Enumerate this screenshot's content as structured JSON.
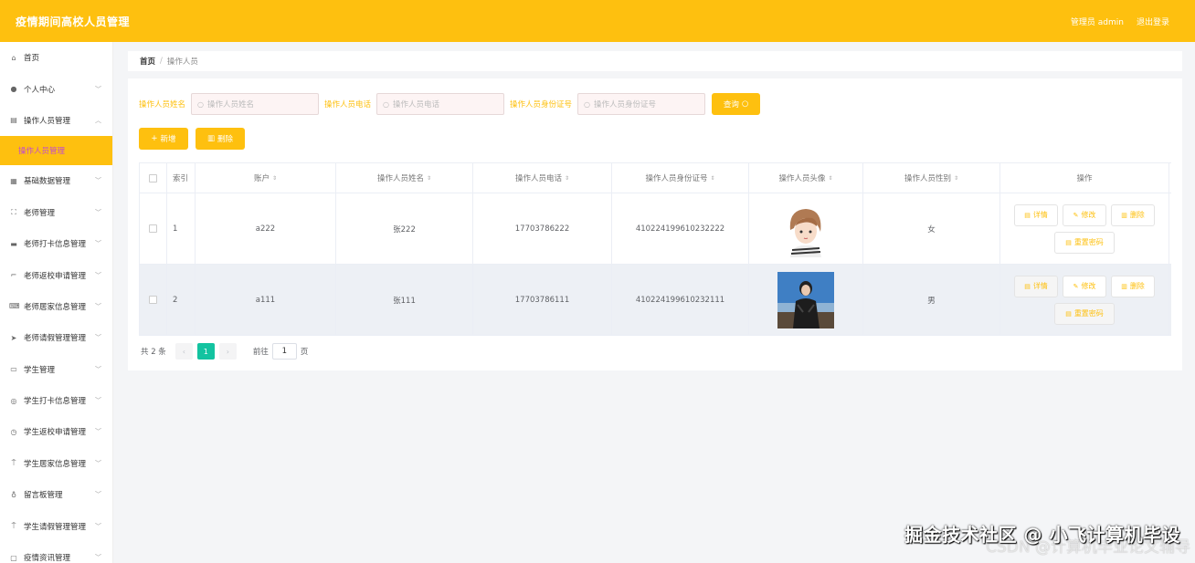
{
  "app_title": "疫情期间高校人员管理",
  "header": {
    "admin_label": "管理员 admin",
    "logout_label": "退出登录"
  },
  "sidebar": {
    "items": [
      {
        "label": "首页",
        "icon": "home-icon"
      },
      {
        "label": "个人中心",
        "icon": "user-icon"
      },
      {
        "label": "操作人员管理",
        "icon": "list-icon"
      },
      {
        "label": "操作人员管理",
        "icon": "",
        "active": true
      },
      {
        "label": "基础数据管理",
        "icon": "database-icon"
      },
      {
        "label": "老师管理",
        "icon": "fullscreen-icon"
      },
      {
        "label": "老师打卡信息管理",
        "icon": "card-icon"
      },
      {
        "label": "老师返校申请管理",
        "icon": "crop-icon"
      },
      {
        "label": "老师居家信息管理",
        "icon": "keyboard-icon"
      },
      {
        "label": "老师请假管理管理",
        "icon": "send-icon"
      },
      {
        "label": "学生管理",
        "icon": "chat-icon"
      },
      {
        "label": "学生打卡信息管理",
        "icon": "compass-icon"
      },
      {
        "label": "学生返校申请管理",
        "icon": "clock-icon"
      },
      {
        "label": "学生居家信息管理",
        "icon": "guide-icon"
      },
      {
        "label": "留言板管理",
        "icon": "mic-icon"
      },
      {
        "label": "学生请假管理管理",
        "icon": "sign-icon"
      },
      {
        "label": "疫情资讯管理",
        "icon": "doc-icon"
      }
    ]
  },
  "breadcrumb": {
    "home": "首页",
    "separator": "/",
    "current": "操作人员"
  },
  "search": {
    "name_label": "操作人员姓名",
    "name_placeholder": "操作人员姓名",
    "phone_label": "操作人员电话",
    "phone_placeholder": "操作人员电话",
    "idcard_label": "操作人员身份证号",
    "idcard_placeholder": "操作人员身份证号",
    "query_label": "查询"
  },
  "actions": {
    "add_label": "新增",
    "delete_label": "删除"
  },
  "table": {
    "headers": [
      "索引",
      "账户",
      "操作人员姓名",
      "操作人员电话",
      "操作人员身份证号",
      "操作人员头像",
      "操作人员性别",
      "操作"
    ],
    "rows": [
      {
        "index": "1",
        "account": "a222",
        "name": "张222",
        "phone": "17703786222",
        "idcard": "410224199610232222",
        "gender": "女"
      },
      {
        "index": "2",
        "account": "a111",
        "name": "张111",
        "phone": "17703786111",
        "idcard": "410224199610232111",
        "gender": "男"
      }
    ],
    "op_labels": {
      "detail": "详情",
      "edit": "修改",
      "delete": "删除",
      "reset_password": "重置密码"
    }
  },
  "pagination": {
    "total": "共 2 条",
    "current_page": "1",
    "goto_label": "前往",
    "goto_value": "1",
    "page_suffix": "页"
  },
  "watermark": {
    "line1": "掘金技术社区 @ 小飞计算机毕设",
    "line2": "CSDN @计算机毕业论文辅导"
  },
  "colors": {
    "accent": "#fec00f",
    "active_text": "#c04bd1",
    "pager_active": "#13c3a0"
  }
}
